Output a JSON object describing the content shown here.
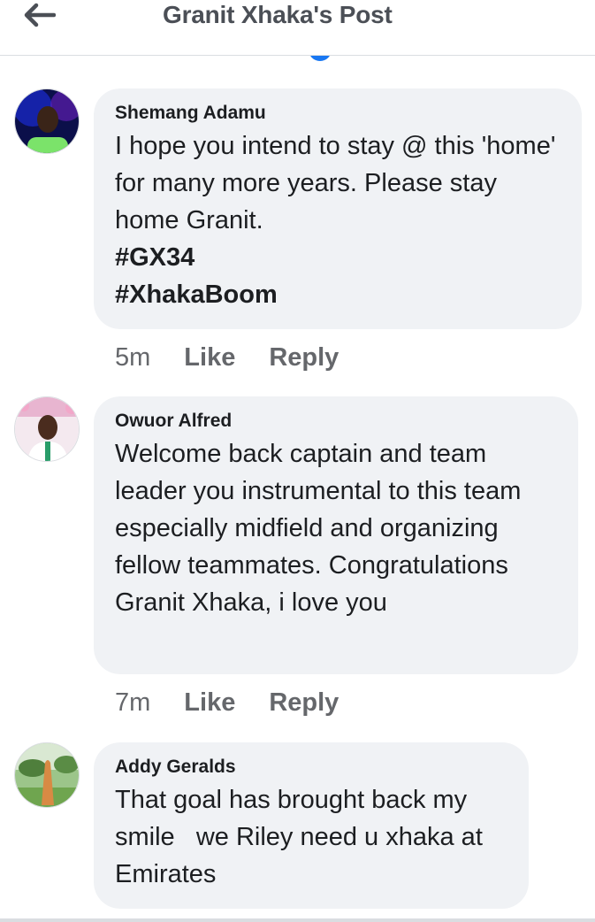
{
  "header": {
    "title": "Granit Xhaka's Post",
    "back_icon": "arrow-left-icon"
  },
  "comments": [
    {
      "author": "Shemang Adamu",
      "text": "I hope you intend to stay @ this 'home' for many more years. Please stay home Granit.",
      "tags": [
        "#GX34",
        "#XhakaBoom"
      ],
      "time": "5m",
      "like_label": "Like",
      "reply_label": "Reply"
    },
    {
      "author": "Owuor Alfred",
      "text": "Welcome back captain and team leader you instrumental to this team especially midfield and organizing fellow teammates. Congratulations Granit Xhaka, i love you",
      "time": "7m",
      "like_label": "Like",
      "reply_label": "Reply"
    },
    {
      "author": "Addy Geralds",
      "text": "That goal has brought back my smile   we Riley need u xhaka at Emirates"
    }
  ],
  "colors": {
    "bubble": "#f0f2f5",
    "meta": "#65676b",
    "text": "#1c1e21",
    "header_title": "#4b4f56"
  }
}
